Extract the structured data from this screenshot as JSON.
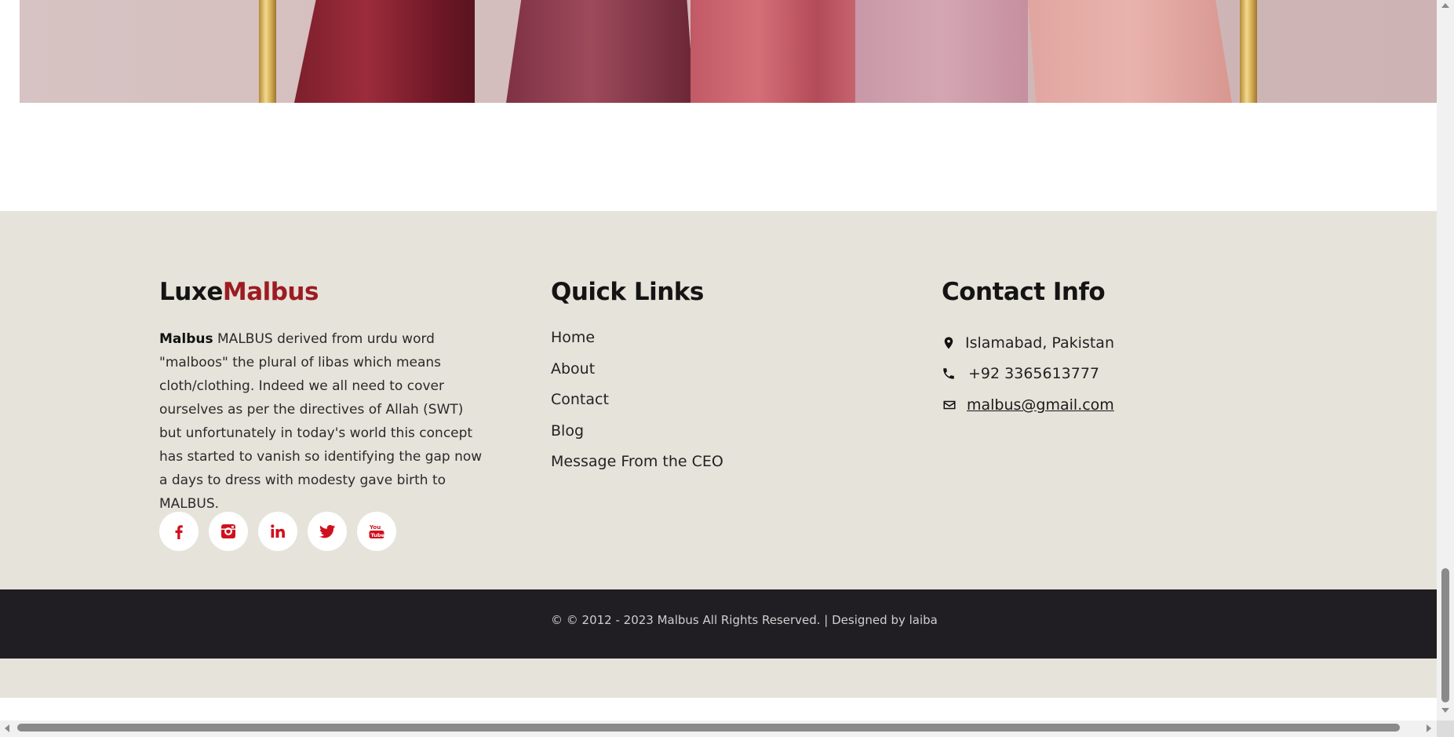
{
  "brand": {
    "part1": "Luxe",
    "part2": "Malbus",
    "accent_color": "#9b1c22"
  },
  "about": {
    "bold": "Malbus",
    "text": "MALBUS derived from urdu word \"malboos\" the plural of libas which means cloth/clothing. Indeed we all need to cover ourselves as per the directives of Allah (SWT) but unfortunately in today's world this concept has started to vanish so identifying the gap now a days to dress with modesty gave birth to MALBUS."
  },
  "socials": [
    {
      "icon": "facebook-icon"
    },
    {
      "icon": "instagram-icon"
    },
    {
      "icon": "linkedin-icon"
    },
    {
      "icon": "twitter-icon"
    },
    {
      "icon": "youtube-icon"
    }
  ],
  "social_icon_color": "#d0101e",
  "quick_links": {
    "heading": "Quick Links",
    "items": [
      {
        "label": "Home"
      },
      {
        "label": "About"
      },
      {
        "label": "Contact"
      },
      {
        "label": "Blog"
      },
      {
        "label": "Message From the CEO"
      }
    ]
  },
  "contact": {
    "heading": "Contact Info",
    "address": "Islamabad, Pakistan",
    "phone": "+92 3365613777",
    "email": "malbus@gmail.com"
  },
  "footer": {
    "copyright": "© © 2012 - 2023 Malbus All Rights Reserved. | Designed by laiba",
    "background": "#e6e3da",
    "bar_background": "#201e22"
  }
}
